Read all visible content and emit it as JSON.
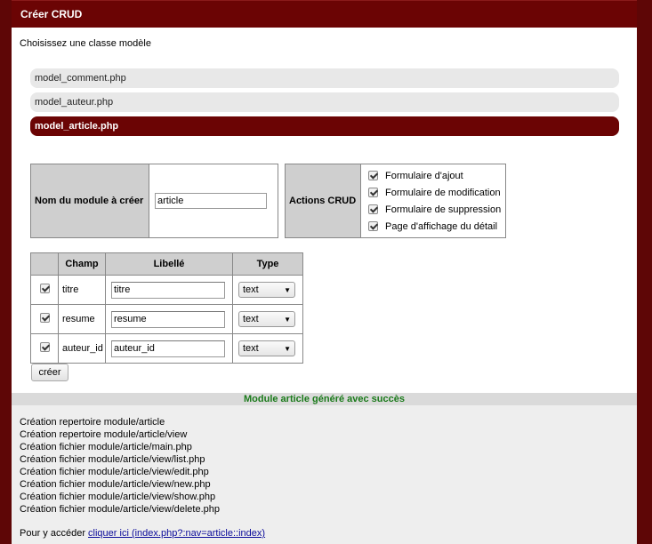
{
  "window": {
    "title": "Créer CRUD"
  },
  "instruction": "Choisissez une classe modèle",
  "models": [
    {
      "label": "model_comment.php",
      "selected": false
    },
    {
      "label": "model_auteur.php",
      "selected": false
    },
    {
      "label": "model_article.php",
      "selected": true
    }
  ],
  "module": {
    "label": "Nom du module à créer",
    "value": "article"
  },
  "actions": {
    "label": "Actions CRUD",
    "items": [
      {
        "label": "Formulaire d'ajout",
        "checked": true
      },
      {
        "label": "Formulaire de modification",
        "checked": true
      },
      {
        "label": "Formulaire de suppression",
        "checked": true
      },
      {
        "label": "Page d'affichage du détail",
        "checked": true
      }
    ]
  },
  "fields": {
    "headers": {
      "check": "",
      "champ": "Champ",
      "libelle": "Libellé",
      "type": "Type"
    },
    "rows": [
      {
        "checked": true,
        "champ": "titre",
        "libelle": "titre",
        "type": "text"
      },
      {
        "checked": true,
        "champ": "resume",
        "libelle": "resume",
        "type": "text"
      },
      {
        "checked": true,
        "champ": "auteur_id",
        "libelle": "auteur_id",
        "type": "text"
      }
    ]
  },
  "submit_label": "créer",
  "success_message": "Module article généré avec succès",
  "log": [
    "Création repertoire module/article",
    "Création repertoire module/article/view",
    "Création fichier module/article/main.php",
    "Création fichier module/article/view/list.php",
    "Création fichier module/article/view/edit.php",
    "Création fichier module/article/view/new.php",
    "Création fichier module/article/view/show.php",
    "Création fichier module/article/view/delete.php"
  ],
  "access": {
    "prefix": "Pour y accéder",
    "link_label": "cliquer ici (index.php?:nav=article::index)"
  },
  "colors": {
    "brand": "#6b0404",
    "success": "#1a7a1a",
    "link": "#0b0b9a"
  }
}
